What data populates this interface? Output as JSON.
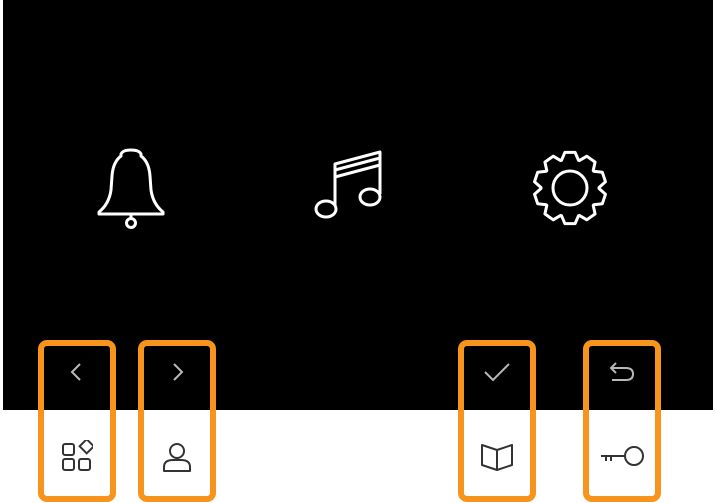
{
  "colors": {
    "screen_background": "#000000",
    "panel_background": "#ffffff",
    "highlight_frame": "#F7941D",
    "menu_icon_stroke": "#ffffff",
    "screen_key_icon_stroke": "#b8b8b8",
    "panel_key_icon_stroke": "#333333"
  },
  "menu": {
    "items": [
      {
        "icon": "bell-icon"
      },
      {
        "icon": "music-note-icon"
      },
      {
        "icon": "gear-icon"
      }
    ]
  },
  "touch_keys": [
    {
      "top_icon": "chevron-left-icon",
      "bottom_icon": "apps-grid-icon"
    },
    {
      "top_icon": "chevron-right-icon",
      "bottom_icon": "user-icon"
    },
    {
      "top_icon": "checkmark-icon",
      "bottom_icon": "book-icon"
    },
    {
      "top_icon": "return-arrow-icon",
      "bottom_icon": "key-icon"
    }
  ]
}
